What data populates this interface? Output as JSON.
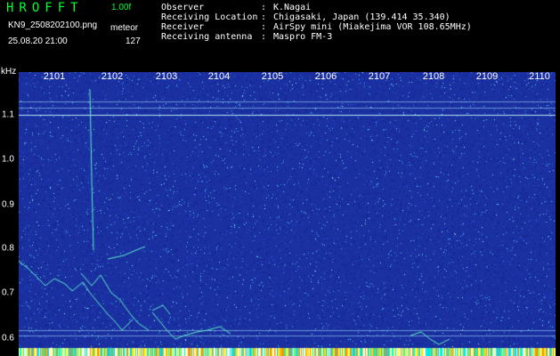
{
  "header": {
    "app_title": "HROFFT",
    "version": "1.00f",
    "filename": "KN9_2508202100.png",
    "mode": "meteor",
    "datetime": "25.08.20 21:00",
    "count": "127"
  },
  "info": [
    {
      "label": "Observer",
      "value": "K.Nagai"
    },
    {
      "label": "Receiving Location",
      "value": "Chigasaki, Japan (139.414 35.340)"
    },
    {
      "label": "Receiver",
      "value": "AirSpy mini (Miakejima VOR 108.65MHz)"
    },
    {
      "label": "Receiving antenna",
      "value": "Maspro FM-3"
    }
  ],
  "plot": {
    "y_unit": "kHz",
    "y_ticks": [
      "1.1",
      "1.0",
      "0.9",
      "0.8",
      "0.7",
      "0.6"
    ],
    "time_labels": [
      "2101",
      "2102",
      "2103",
      "2104",
      "2105",
      "2106",
      "2107",
      "2108",
      "2109",
      "2110"
    ]
  },
  "colors": {
    "background": "#000000",
    "waterfall_base": "#1a2fa0",
    "noise_speck": "#3fc8e8",
    "title_green": "#00ff33",
    "text": "#ffffff"
  }
}
